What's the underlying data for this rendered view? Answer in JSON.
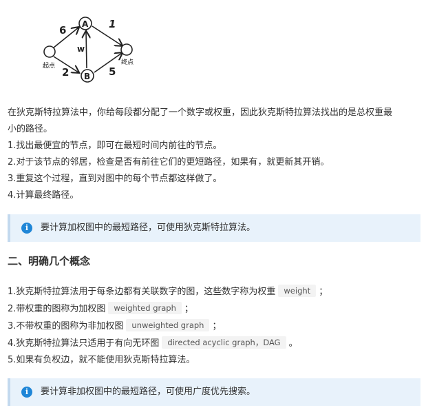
{
  "figure": {
    "node_a": "A",
    "node_b": "B",
    "weight_start_a": "6",
    "weight_a_end": "1",
    "weight_start_b": "2",
    "weight_b_end": "5",
    "weight_b_a": "w",
    "start_label": "起点",
    "end_label": "终点"
  },
  "intro": {
    "line1": "在狄克斯特拉算法中，你给每段都分配了一个数字或权重，因此狄克斯特拉算法找出的是总权重最",
    "line2": "小的路径。",
    "steps": [
      "1.找出最便宜的节点，即可在最短时间内前往的节点。",
      "2.对于该节点的邻居，检查是否有前往它们的更短路径，如果有，就更新其开销。",
      "3.重复这个过程，直到对图中的每个节点都这样做了。",
      "4.计算最终路径。"
    ]
  },
  "note1": {
    "icon": "info-icon",
    "text": "要计算加权图中的最短路径，可使用狄克斯特拉算法。"
  },
  "section": {
    "title": "二、明确几个概念"
  },
  "concepts": [
    {
      "text": "1.狄克斯特拉算法用于每条边都有关联数字的图，这些数字称为权重",
      "code": "weight",
      "suffix": "；"
    },
    {
      "text": "2.带权重的图称为加权图",
      "code": "weighted graph",
      "suffix": "；"
    },
    {
      "text": "3.不带权重的图称为非加权图",
      "code": "unweighted graph",
      "suffix": "；"
    },
    {
      "text": "4.狄克斯特拉算法只适用于有向无环图",
      "code": "directed acyclic graph，DAG",
      "suffix": "。"
    },
    {
      "text": "5.如果有负权边，就不能使用狄克斯特拉算法。"
    }
  ],
  "note2": {
    "icon": "info-icon",
    "text": "要计算非加权图中的最短路径，可使用广度优先搜索。"
  },
  "colors": {
    "note_bg": "#e8f2fb",
    "note_border": "#c3d9ee",
    "info_icon": "#1f86d7",
    "code_bg": "#f3f3f3"
  }
}
